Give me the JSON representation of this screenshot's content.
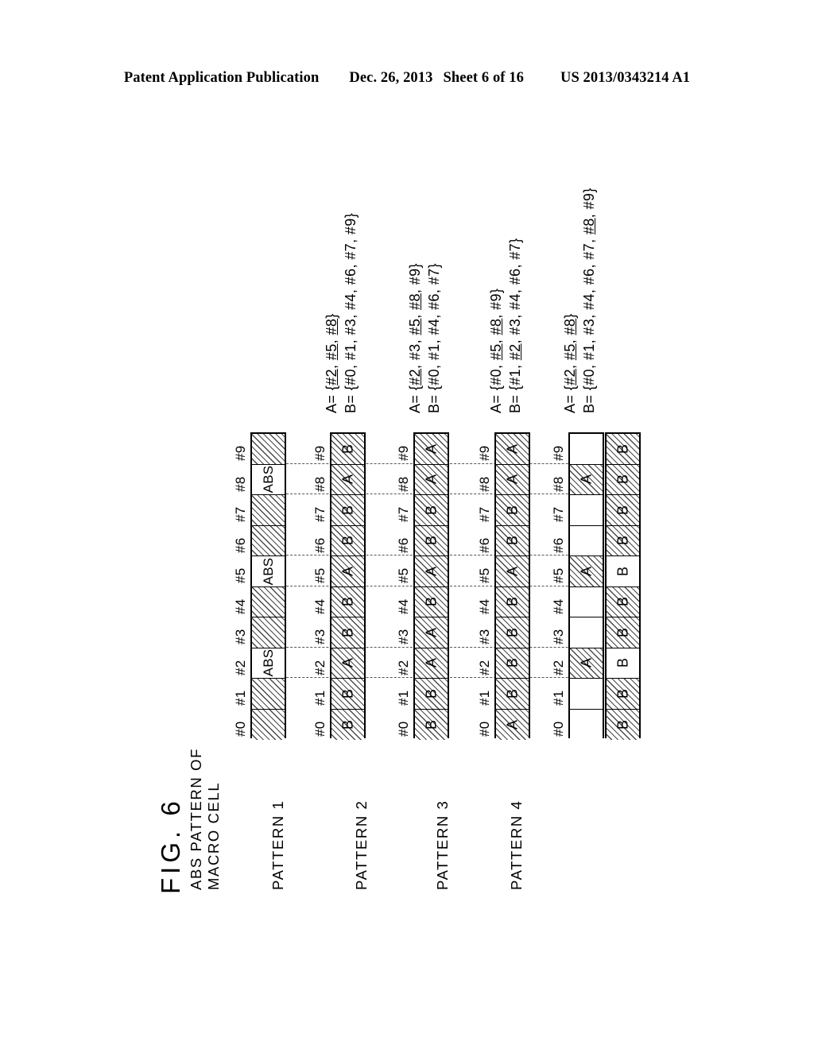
{
  "header": {
    "publication": "Patent Application Publication",
    "date": "Dec. 26, 2013",
    "sheet": "Sheet 6 of 16",
    "patent_number": "US 2013/0343214 A1"
  },
  "figure": {
    "title": "FIG. 6",
    "slot_labels": [
      "#0",
      "#1",
      "#2",
      "#3",
      "#4",
      "#5",
      "#6",
      "#7",
      "#8",
      "#9"
    ],
    "rows": [
      {
        "id": "abs-pattern-macro-cell",
        "label_line1": "ABS PATTERN OF",
        "label_line2": "MACRO CELL",
        "strips": [
          {
            "id": "abs-row",
            "cells": [
              {
                "text": "",
                "fill": "hatch"
              },
              {
                "text": "",
                "fill": "hatch"
              },
              {
                "text": "ABS",
                "fill": "blank"
              },
              {
                "text": "",
                "fill": "hatch"
              },
              {
                "text": "",
                "fill": "hatch"
              },
              {
                "text": "ABS",
                "fill": "blank"
              },
              {
                "text": "",
                "fill": "hatch"
              },
              {
                "text": "",
                "fill": "hatch"
              },
              {
                "text": "ABS",
                "fill": "blank"
              },
              {
                "text": "",
                "fill": "hatch"
              }
            ]
          }
        ],
        "equations": []
      },
      {
        "id": "pattern-1",
        "label_line1": "PATTERN 1",
        "label_line2": "",
        "strips": [
          {
            "id": "pattern-1-row",
            "cells": [
              {
                "text": "B",
                "fill": "hatch"
              },
              {
                "text": "B",
                "fill": "hatch"
              },
              {
                "text": "A",
                "fill": "hatch"
              },
              {
                "text": "B",
                "fill": "hatch"
              },
              {
                "text": "B",
                "fill": "hatch"
              },
              {
                "text": "A",
                "fill": "hatch"
              },
              {
                "text": "B",
                "fill": "hatch"
              },
              {
                "text": "B",
                "fill": "hatch"
              },
              {
                "text": "A",
                "fill": "hatch"
              },
              {
                "text": "B",
                "fill": "hatch"
              }
            ]
          }
        ],
        "equations": [
          {
            "id": "pattern-1-eq-a",
            "html": "A= {<u>#2</u>, <u>#5</u>, <u>#8</u>}"
          },
          {
            "id": "pattern-1-eq-b",
            "html": "B= {#0, #1, #3, #4, #6, #7, #9}"
          }
        ]
      },
      {
        "id": "pattern-2",
        "label_line1": "PATTERN 2",
        "label_line2": "",
        "strips": [
          {
            "id": "pattern-2-row",
            "cells": [
              {
                "text": "B",
                "fill": "hatch"
              },
              {
                "text": "B",
                "fill": "hatch"
              },
              {
                "text": "A",
                "fill": "hatch"
              },
              {
                "text": "A",
                "fill": "hatch"
              },
              {
                "text": "B",
                "fill": "hatch"
              },
              {
                "text": "A",
                "fill": "hatch"
              },
              {
                "text": "B",
                "fill": "hatch"
              },
              {
                "text": "B",
                "fill": "hatch"
              },
              {
                "text": "A",
                "fill": "hatch"
              },
              {
                "text": "A",
                "fill": "hatch"
              }
            ]
          }
        ],
        "equations": [
          {
            "id": "pattern-2-eq-a",
            "html": "A= {<u>#2</u>, #3, <u>#5</u>, <u>#8</u>, #9}"
          },
          {
            "id": "pattern-2-eq-b",
            "html": "B= {#0, #1, #4, #6, #7}"
          }
        ]
      },
      {
        "id": "pattern-3",
        "label_line1": "PATTERN 3",
        "label_line2": "",
        "strips": [
          {
            "id": "pattern-3-row",
            "cells": [
              {
                "text": "A",
                "fill": "hatch"
              },
              {
                "text": "B",
                "fill": "hatch"
              },
              {
                "text": "B",
                "fill": "hatch"
              },
              {
                "text": "B",
                "fill": "hatch"
              },
              {
                "text": "B",
                "fill": "hatch"
              },
              {
                "text": "A",
                "fill": "hatch"
              },
              {
                "text": "B",
                "fill": "hatch"
              },
              {
                "text": "B",
                "fill": "hatch"
              },
              {
                "text": "A",
                "fill": "hatch"
              },
              {
                "text": "A",
                "fill": "hatch"
              }
            ]
          }
        ],
        "equations": [
          {
            "id": "pattern-3-eq-a",
            "html": "A= {#0, <u>#5</u>, <u>#8</u>, #9}"
          },
          {
            "id": "pattern-3-eq-b",
            "html": "B= {#1, <u>#2</u>, #3, #4, #6, #7}"
          }
        ]
      },
      {
        "id": "pattern-4",
        "label_line1": "PATTERN 4",
        "label_line2": "",
        "strips": [
          {
            "id": "pattern-4-row-a",
            "cells": [
              {
                "text": "",
                "fill": "blank"
              },
              {
                "text": "",
                "fill": "blank"
              },
              {
                "text": "A",
                "fill": "hatch"
              },
              {
                "text": "",
                "fill": "blank"
              },
              {
                "text": "",
                "fill": "blank"
              },
              {
                "text": "A",
                "fill": "hatch"
              },
              {
                "text": "",
                "fill": "blank"
              },
              {
                "text": "",
                "fill": "blank"
              },
              {
                "text": "A",
                "fill": "hatch"
              },
              {
                "text": "",
                "fill": "blank"
              }
            ]
          },
          {
            "id": "pattern-4-row-b",
            "cells": [
              {
                "text": "B",
                "fill": "hatch"
              },
              {
                "text": "B",
                "fill": "hatch"
              },
              {
                "text": "B",
                "fill": "blank"
              },
              {
                "text": "B",
                "fill": "hatch"
              },
              {
                "text": "B",
                "fill": "hatch"
              },
              {
                "text": "B",
                "fill": "blank"
              },
              {
                "text": "B",
                "fill": "hatch"
              },
              {
                "text": "B",
                "fill": "hatch"
              },
              {
                "text": "B",
                "fill": "hatch"
              },
              {
                "text": "B",
                "fill": "hatch"
              }
            ]
          }
        ],
        "equations": [
          {
            "id": "pattern-4-eq-a",
            "html": "A= {<u>#2</u>, <u>#5</u>, <u>#8</u>}"
          },
          {
            "id": "pattern-4-eq-b",
            "html": "B= {#0, #1, #3, #4, #6, #7, <u>#8</u>, #9}"
          }
        ]
      }
    ]
  }
}
